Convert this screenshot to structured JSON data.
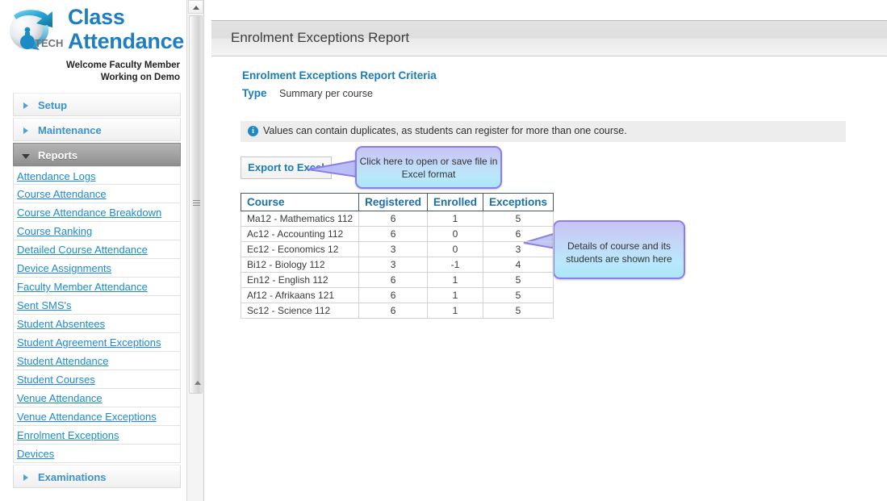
{
  "brand": {
    "logo_icon": "globe-arrow-logo",
    "logo_text": "iP TECH",
    "title_line1": "Class",
    "title_line2": "Attendance",
    "welcome": "Welcome Faculty Member",
    "working_on": "Working on Demo"
  },
  "sidebar": {
    "sections": [
      {
        "label": "Setup",
        "expanded": false,
        "arrow_icon": "chevron-right-icon"
      },
      {
        "label": "Maintenance",
        "expanded": false,
        "arrow_icon": "chevron-right-icon"
      },
      {
        "label": "Reports",
        "expanded": true,
        "arrow_icon": "chevron-down-icon"
      },
      {
        "label": "Examinations",
        "expanded": false,
        "arrow_icon": "chevron-right-icon"
      }
    ],
    "reports_links": [
      "Attendance Logs",
      "Course Attendance",
      "Course Attendance Breakdown",
      "Course Ranking",
      "Detailed Course Attendance",
      "Device Assignments",
      "Faculty Member Attendance",
      "Sent SMS's",
      "Student Absentees",
      "Student Agreement Exceptions",
      "Student Attendance",
      "Student Courses",
      "Venue Attendance",
      "Venue Attendance Exceptions",
      "Enrolment Exceptions",
      "Devices"
    ]
  },
  "scrollbar": {
    "up_arrow_icon": "scroll-up-arrow-icon",
    "down_arrow_icon": "scroll-down-arrow-icon",
    "grip_icon": "scroll-grip-icon"
  },
  "page": {
    "title": "Enrolment Exceptions Report",
    "criteria_heading": "Enrolment Exceptions Report Criteria",
    "criteria_type_label": "Type",
    "criteria_type_value": "Summary per course",
    "info_icon": "info-circle-icon",
    "info_message": "Values can contain duplicates, as students can register for more than one course.",
    "export_label": "Export to Excel"
  },
  "callouts": [
    {
      "text": "Click here to open or save file in Excel format"
    },
    {
      "text": "Details of course and its students are shown here"
    }
  ],
  "table": {
    "columns": [
      "Course",
      "Registered",
      "Enrolled",
      "Exceptions"
    ],
    "rows": [
      {
        "course": "Ma12 - Mathematics 112",
        "registered": "6",
        "enrolled": "1",
        "exceptions": "5"
      },
      {
        "course": "Ac12 - Accounting 112",
        "registered": "6",
        "enrolled": "0",
        "exceptions": "6"
      },
      {
        "course": "Ec12 - Economics 12",
        "registered": "3",
        "enrolled": "0",
        "exceptions": "3"
      },
      {
        "course": "Bi12 - Biology 112",
        "registered": "3",
        "enrolled": "-1",
        "exceptions": "4"
      },
      {
        "course": "En12 - English 112",
        "registered": "6",
        "enrolled": "1",
        "exceptions": "5"
      },
      {
        "course": "Af12 - Afrikaans 121",
        "registered": "6",
        "enrolled": "1",
        "exceptions": "5"
      },
      {
        "course": "Sc12 - Science 112",
        "registered": "6",
        "enrolled": "1",
        "exceptions": "5"
      }
    ]
  },
  "colors": {
    "brand_blue": "#1f7ec0",
    "link_blue": "#1b8ad4",
    "callout_border": "#8a7fe8",
    "active_section_gray": "#a3a3a3"
  }
}
